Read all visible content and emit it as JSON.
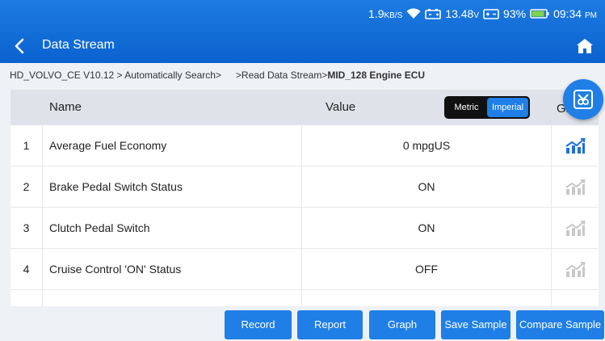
{
  "status_bar": {
    "net_speed": "1.9",
    "net_unit": "KB/S",
    "voltage": "13.48",
    "voltage_unit": "V",
    "battery_percent": "93%",
    "time": "09:34",
    "ampm": "PM"
  },
  "header": {
    "title": "Data Stream",
    "back_icon": "chevron-left-icon",
    "home_icon": "home-icon"
  },
  "breadcrumb": {
    "path1": "HD_VOLVO_CE V10.12 > Automatically Search>",
    "path2": ">Read Data Stream>",
    "current": "MID_128 Engine ECU"
  },
  "table": {
    "headers": {
      "name": "Name",
      "value": "Value",
      "graph": "Graph"
    },
    "unit_toggle": {
      "metric": "Metric",
      "imperial": "Imperial",
      "selected": "Imperial"
    },
    "rows": [
      {
        "num": "1",
        "name": "Average Fuel Economy",
        "value": "0 mpgUS",
        "graph_active": true
      },
      {
        "num": "2",
        "name": "Brake Pedal Switch Status",
        "value": "ON",
        "graph_active": false
      },
      {
        "num": "3",
        "name": "Clutch Pedal Switch",
        "value": "ON",
        "graph_active": false
      },
      {
        "num": "4",
        "name": "Cruise Control 'ON' Status",
        "value": "OFF",
        "graph_active": false
      }
    ]
  },
  "fab": {
    "icon": "exit-icon"
  },
  "buttons": {
    "record": "Record",
    "report": "Report",
    "graph": "Graph",
    "save_sample": "Save Sample",
    "compare_sample": "Compare Sample"
  },
  "colors": {
    "header_blue": "#0a62cf",
    "accent_blue": "#1f7fe6",
    "graph_active": "#1f6fd8",
    "graph_inactive": "#c8c8c8"
  }
}
